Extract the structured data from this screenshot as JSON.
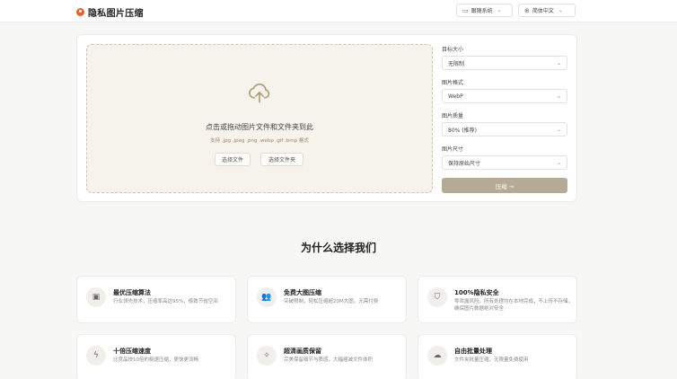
{
  "header": {
    "logo_text": "隐私图片压缩",
    "theme_label": "跟随系统",
    "lang_label": "简体中文",
    "icons": {
      "theme": "monitor-icon",
      "lang": "globe-icon"
    }
  },
  "upload": {
    "title": "点击或拖动图片文件和文件夹到此",
    "hint": "支持 .jpg .jpeg .png .webp .gif .bmp 格式",
    "select_file": "选择文件",
    "select_folder": "选择文件夹"
  },
  "settings": {
    "target_size": {
      "label": "目标大小",
      "value": "无限制"
    },
    "format": {
      "label": "图片格式",
      "value": "WebP"
    },
    "quality": {
      "label": "图片质量",
      "value": "80% (推荐)"
    },
    "dimension": {
      "label": "图片尺寸",
      "value": "保持原始尺寸"
    },
    "start_label": "压缩 →"
  },
  "why": {
    "title": "为什么选择我们",
    "features": [
      {
        "icon": "chip-icon",
        "title": "最优压缩算法",
        "desc": "行业领先技术，压缩率高达95%，极致节省空间"
      },
      {
        "icon": "users-icon",
        "title": "免费大图压缩",
        "desc": "突破限制，轻松压缩超20M大图，无需付费"
      },
      {
        "icon": "shield-icon",
        "title": "100%隐私安全",
        "desc": "零泄露风险，所有处理均在本地完成，不上传不存储，确保图片数据绝对安全"
      },
      {
        "icon": "bolt-icon",
        "title": "十倍压缩速度",
        "desc": "比竞品快10倍的极速压缩，更快更流畅"
      },
      {
        "icon": "sparkle-icon",
        "title": "超清画质保留",
        "desc": "完美保留细节与质感，大幅缩减文件体积"
      },
      {
        "icon": "cloud-icon",
        "title": "自由批量处理",
        "desc": "文件夹批量压缩，无限量免费使用"
      }
    ]
  }
}
